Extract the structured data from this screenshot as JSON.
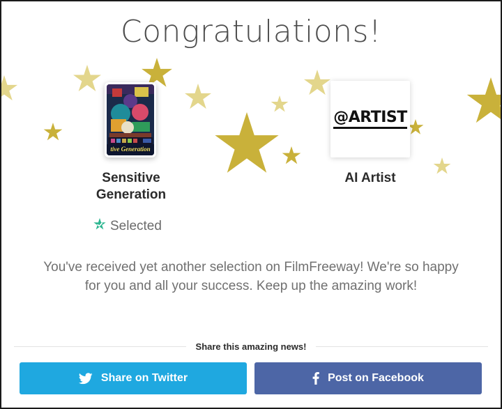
{
  "title": "Congratulations!",
  "film": {
    "name": "Sensitive Generation",
    "poster_caption": "tive Generation",
    "status": "Selected",
    "status_icon": "star-check-icon"
  },
  "festival": {
    "name": "AI Artist",
    "logo_text": "@ARTIST"
  },
  "message": "You've received yet another selection on FilmFreeway! We're so happy for you and all your success. Keep up the amazing work!",
  "share": {
    "label": "Share this amazing news!",
    "twitter_label": "Share on Twitter",
    "twitter_icon": "twitter-bird-icon",
    "facebook_label": "Post on Facebook",
    "facebook_icon": "facebook-f-icon"
  },
  "colors": {
    "star_gold": "#c9b13a",
    "star_light": "#e3d68c",
    "twitter": "#1fa8e0",
    "facebook": "#4d66a6",
    "selected_green": "#2bb58f"
  }
}
